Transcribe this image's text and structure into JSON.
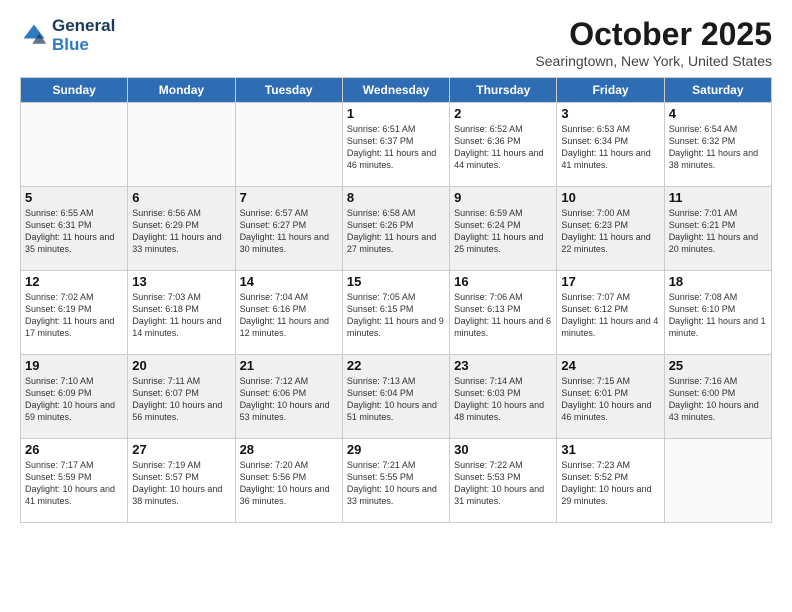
{
  "app": {
    "logo_line1": "General",
    "logo_line2": "Blue",
    "month": "October 2025",
    "location": "Searingtown, New York, United States"
  },
  "days_header": [
    "Sunday",
    "Monday",
    "Tuesday",
    "Wednesday",
    "Thursday",
    "Friday",
    "Saturday"
  ],
  "weeks": [
    [
      {
        "day": "",
        "info": ""
      },
      {
        "day": "",
        "info": ""
      },
      {
        "day": "",
        "info": ""
      },
      {
        "day": "1",
        "info": "Sunrise: 6:51 AM\nSunset: 6:37 PM\nDaylight: 11 hours\nand 46 minutes."
      },
      {
        "day": "2",
        "info": "Sunrise: 6:52 AM\nSunset: 6:36 PM\nDaylight: 11 hours\nand 44 minutes."
      },
      {
        "day": "3",
        "info": "Sunrise: 6:53 AM\nSunset: 6:34 PM\nDaylight: 11 hours\nand 41 minutes."
      },
      {
        "day": "4",
        "info": "Sunrise: 6:54 AM\nSunset: 6:32 PM\nDaylight: 11 hours\nand 38 minutes."
      }
    ],
    [
      {
        "day": "5",
        "info": "Sunrise: 6:55 AM\nSunset: 6:31 PM\nDaylight: 11 hours\nand 35 minutes."
      },
      {
        "day": "6",
        "info": "Sunrise: 6:56 AM\nSunset: 6:29 PM\nDaylight: 11 hours\nand 33 minutes."
      },
      {
        "day": "7",
        "info": "Sunrise: 6:57 AM\nSunset: 6:27 PM\nDaylight: 11 hours\nand 30 minutes."
      },
      {
        "day": "8",
        "info": "Sunrise: 6:58 AM\nSunset: 6:26 PM\nDaylight: 11 hours\nand 27 minutes."
      },
      {
        "day": "9",
        "info": "Sunrise: 6:59 AM\nSunset: 6:24 PM\nDaylight: 11 hours\nand 25 minutes."
      },
      {
        "day": "10",
        "info": "Sunrise: 7:00 AM\nSunset: 6:23 PM\nDaylight: 11 hours\nand 22 minutes."
      },
      {
        "day": "11",
        "info": "Sunrise: 7:01 AM\nSunset: 6:21 PM\nDaylight: 11 hours\nand 20 minutes."
      }
    ],
    [
      {
        "day": "12",
        "info": "Sunrise: 7:02 AM\nSunset: 6:19 PM\nDaylight: 11 hours\nand 17 minutes."
      },
      {
        "day": "13",
        "info": "Sunrise: 7:03 AM\nSunset: 6:18 PM\nDaylight: 11 hours\nand 14 minutes."
      },
      {
        "day": "14",
        "info": "Sunrise: 7:04 AM\nSunset: 6:16 PM\nDaylight: 11 hours\nand 12 minutes."
      },
      {
        "day": "15",
        "info": "Sunrise: 7:05 AM\nSunset: 6:15 PM\nDaylight: 11 hours\nand 9 minutes."
      },
      {
        "day": "16",
        "info": "Sunrise: 7:06 AM\nSunset: 6:13 PM\nDaylight: 11 hours\nand 6 minutes."
      },
      {
        "day": "17",
        "info": "Sunrise: 7:07 AM\nSunset: 6:12 PM\nDaylight: 11 hours\nand 4 minutes."
      },
      {
        "day": "18",
        "info": "Sunrise: 7:08 AM\nSunset: 6:10 PM\nDaylight: 11 hours\nand 1 minute."
      }
    ],
    [
      {
        "day": "19",
        "info": "Sunrise: 7:10 AM\nSunset: 6:09 PM\nDaylight: 10 hours\nand 59 minutes."
      },
      {
        "day": "20",
        "info": "Sunrise: 7:11 AM\nSunset: 6:07 PM\nDaylight: 10 hours\nand 56 minutes."
      },
      {
        "day": "21",
        "info": "Sunrise: 7:12 AM\nSunset: 6:06 PM\nDaylight: 10 hours\nand 53 minutes."
      },
      {
        "day": "22",
        "info": "Sunrise: 7:13 AM\nSunset: 6:04 PM\nDaylight: 10 hours\nand 51 minutes."
      },
      {
        "day": "23",
        "info": "Sunrise: 7:14 AM\nSunset: 6:03 PM\nDaylight: 10 hours\nand 48 minutes."
      },
      {
        "day": "24",
        "info": "Sunrise: 7:15 AM\nSunset: 6:01 PM\nDaylight: 10 hours\nand 46 minutes."
      },
      {
        "day": "25",
        "info": "Sunrise: 7:16 AM\nSunset: 6:00 PM\nDaylight: 10 hours\nand 43 minutes."
      }
    ],
    [
      {
        "day": "26",
        "info": "Sunrise: 7:17 AM\nSunset: 5:59 PM\nDaylight: 10 hours\nand 41 minutes."
      },
      {
        "day": "27",
        "info": "Sunrise: 7:19 AM\nSunset: 5:57 PM\nDaylight: 10 hours\nand 38 minutes."
      },
      {
        "day": "28",
        "info": "Sunrise: 7:20 AM\nSunset: 5:56 PM\nDaylight: 10 hours\nand 36 minutes."
      },
      {
        "day": "29",
        "info": "Sunrise: 7:21 AM\nSunset: 5:55 PM\nDaylight: 10 hours\nand 33 minutes."
      },
      {
        "day": "30",
        "info": "Sunrise: 7:22 AM\nSunset: 5:53 PM\nDaylight: 10 hours\nand 31 minutes."
      },
      {
        "day": "31",
        "info": "Sunrise: 7:23 AM\nSunset: 5:52 PM\nDaylight: 10 hours\nand 29 minutes."
      },
      {
        "day": "",
        "info": ""
      }
    ]
  ]
}
